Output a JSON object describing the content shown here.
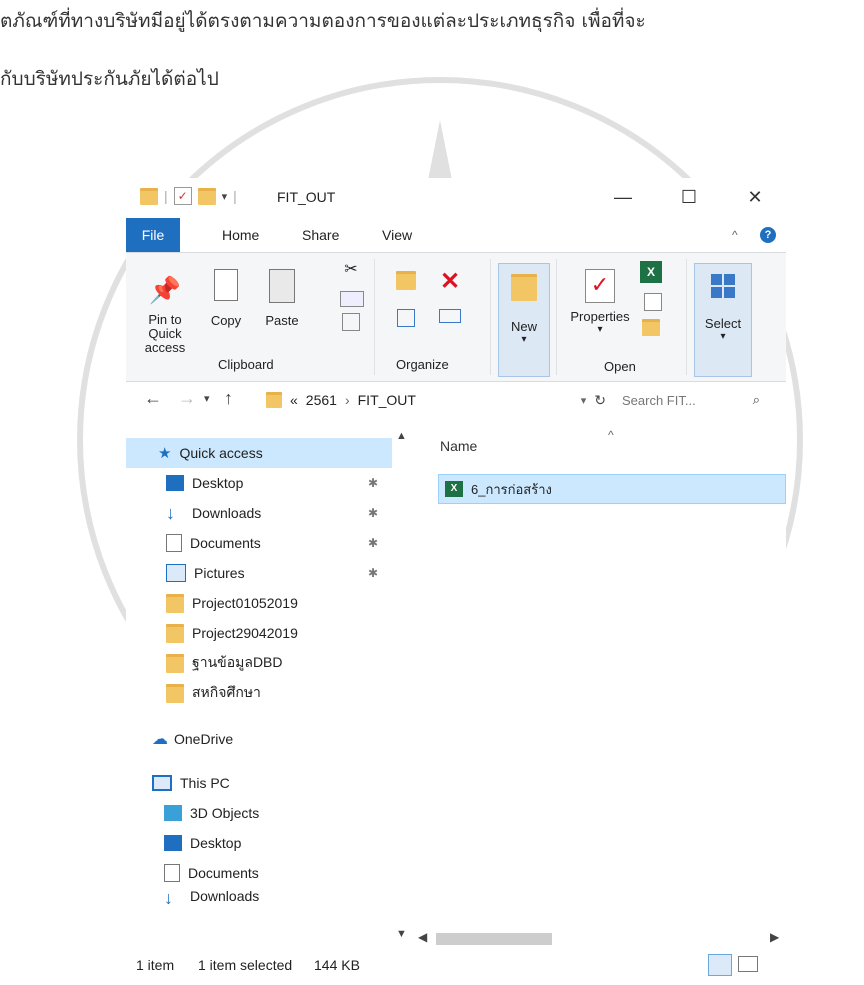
{
  "document": {
    "line1": "ตภัณฑ์ที่ทางบริษัทมีอยู่ได้ตรงตามความตองการของแต่ละประเภทธุรกิจ เพื่อที่จะ",
    "line2": "กับบริษัทประกันภัยได้ต่อไป"
  },
  "window": {
    "title": "FIT_OUT",
    "controls": {
      "minimize": "—",
      "maximize": "☐",
      "close": "✕"
    }
  },
  "tabs": [
    {
      "label": "File"
    },
    {
      "label": "Home"
    },
    {
      "label": "Share"
    },
    {
      "label": "View"
    }
  ],
  "ribbon": {
    "clipboard": {
      "pin_label": "Pin to Quick access",
      "copy_label": "Copy",
      "paste_label": "Paste",
      "group_label": "Clipboard"
    },
    "organize": {
      "group_label": "Organize"
    },
    "new": {
      "new_label": "New"
    },
    "open": {
      "properties_label": "Properties",
      "group_label": "Open"
    },
    "select": {
      "select_label": "Select"
    }
  },
  "address": {
    "path": [
      "«",
      "2561",
      "›",
      "FIT_OUT"
    ],
    "search_placeholder": "Search FIT..."
  },
  "nav": {
    "quick_access": "Quick access",
    "items": [
      {
        "label": "Desktop",
        "pinned": true
      },
      {
        "label": "Downloads",
        "pinned": true
      },
      {
        "label": "Documents",
        "pinned": true
      },
      {
        "label": "Pictures",
        "pinned": true
      },
      {
        "label": "Project01052019"
      },
      {
        "label": "Project29042019"
      },
      {
        "label": "ฐานข้อมูลDBD"
      },
      {
        "label": "สหกิจศึกษา"
      }
    ],
    "onedrive": "OneDrive",
    "this_pc": "This PC",
    "pc_items": [
      {
        "label": "3D Objects"
      },
      {
        "label": "Desktop"
      },
      {
        "label": "Documents"
      },
      {
        "label": "Downloads"
      }
    ]
  },
  "content": {
    "column_header": "Name",
    "files": [
      {
        "name": "6_การก่อสร้าง",
        "icon": "excel-file-icon"
      }
    ]
  },
  "status": {
    "count": "1 item",
    "selected": "1 item selected",
    "size": "144 KB"
  },
  "colors": {
    "file_tab": "#1f6fc0",
    "selection": "#cce8ff",
    "folder": "#f3c665",
    "watermark": "#888888"
  }
}
